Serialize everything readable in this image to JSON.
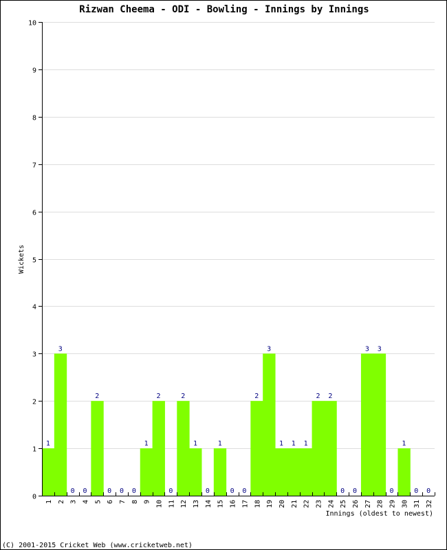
{
  "chart_data": {
    "type": "bar",
    "title": "Rizwan Cheema - ODI - Bowling - Innings by Innings",
    "xlabel": "Innings (oldest to newest)",
    "ylabel": "Wickets",
    "ylim": [
      0,
      10
    ],
    "yticks": [
      "0",
      "1",
      "2",
      "3",
      "4",
      "5",
      "6",
      "7",
      "8",
      "9",
      "10"
    ],
    "grid": true,
    "categories": [
      "1",
      "2",
      "3",
      "4",
      "5",
      "6",
      "7",
      "8",
      "9",
      "10",
      "11",
      "12",
      "13",
      "14",
      "15",
      "16",
      "17",
      "18",
      "19",
      "20",
      "21",
      "22",
      "23",
      "24",
      "25",
      "26",
      "27",
      "28",
      "29",
      "30",
      "31",
      "32"
    ],
    "values": [
      1,
      3,
      0,
      0,
      2,
      0,
      0,
      0,
      1,
      2,
      0,
      2,
      1,
      0,
      1,
      0,
      0,
      2,
      3,
      1,
      1,
      1,
      2,
      2,
      0,
      0,
      3,
      3,
      0,
      1,
      0,
      0
    ],
    "colors": {
      "bar": "#80ff00",
      "data_label": "#000080",
      "grid": "#dddddd",
      "axis": "#000000"
    }
  },
  "footer": "(C) 2001-2015 Cricket Web (www.cricketweb.net)"
}
